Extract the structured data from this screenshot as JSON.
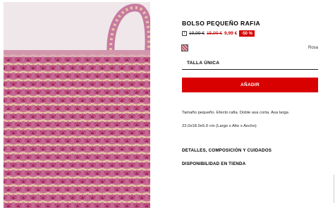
{
  "product": {
    "title": "BOLSO PEQUEÑO RAFIA",
    "price_original": "19,99 €",
    "price_previous": "15,99 €",
    "price_current": "9,99 €",
    "discount_badge": "-50 %",
    "info_icon": "i",
    "color_name": "Rosa",
    "size_label": "TALLA ÚNICA",
    "add_button_label": "AÑADIR",
    "description": "Tamaño pequeño. Efecto rafia. Doble asa corta. Asa larga",
    "dimensions": "22.0x18.0x5.0 cm (Largo x Alto x Ancho)",
    "details_link": "DETALLES, COMPOSICIÓN Y CUIDADOS",
    "availability_link": "DISPONIBILIDAD EN TIENDA"
  },
  "colors": {
    "accent": "#d90000",
    "swatch_primary": "#b5487a",
    "swatch_secondary": "#e8c6a8"
  }
}
